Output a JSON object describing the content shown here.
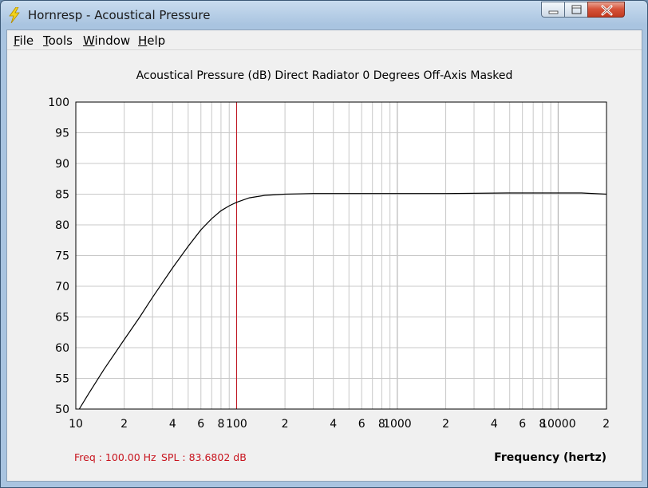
{
  "window": {
    "title": "Hornresp - Acoustical Pressure",
    "controls": [
      "minimize",
      "maximize",
      "close"
    ]
  },
  "menu": {
    "items": [
      {
        "label": "File",
        "mnemonic": "F"
      },
      {
        "label": "Tools",
        "mnemonic": "T"
      },
      {
        "label": "Window",
        "mnemonic": "W"
      },
      {
        "label": "Help",
        "mnemonic": "H"
      }
    ]
  },
  "readout": {
    "freq": "Freq : 100.00 Hz",
    "spl": "SPL : 83.6802 dB"
  },
  "colors": {
    "curve": "#000000",
    "cursor": "#c0101c",
    "grid": "#c8c8c8",
    "grid_decade": "#a8a8a8",
    "readout": "#c8141e"
  },
  "icons": [
    "lightning-bolt-icon",
    "minimize-icon",
    "maximize-icon",
    "close-icon"
  ],
  "chart_data": {
    "type": "line",
    "title": "Acoustical Pressure (dB)   Direct Radiator   0 Degrees Off-Axis   Masked",
    "xlabel": "Frequency (hertz)",
    "ylabel": "",
    "x_scale": "log",
    "xlim": [
      10,
      20000
    ],
    "ylim": [
      50,
      100
    ],
    "grid": true,
    "yticks": [
      100,
      95,
      90,
      85,
      80,
      75,
      70,
      65,
      60,
      55,
      50
    ],
    "xtick_labels": [
      {
        "x": 10,
        "label": "10"
      },
      {
        "x": 20,
        "label": "2"
      },
      {
        "x": 40,
        "label": "4"
      },
      {
        "x": 60,
        "label": "6"
      },
      {
        "x": 80,
        "label": "8"
      },
      {
        "x": 100,
        "label": "100"
      },
      {
        "x": 200,
        "label": "2"
      },
      {
        "x": 400,
        "label": "4"
      },
      {
        "x": 600,
        "label": "6"
      },
      {
        "x": 800,
        "label": "8"
      },
      {
        "x": 1000,
        "label": "1000"
      },
      {
        "x": 2000,
        "label": "2"
      },
      {
        "x": 4000,
        "label": "4"
      },
      {
        "x": 6000,
        "label": "6"
      },
      {
        "x": 8000,
        "label": "8"
      },
      {
        "x": 10000,
        "label": "10000"
      },
      {
        "x": 20000,
        "label": "2"
      }
    ],
    "cursor_x": 100,
    "series": [
      {
        "x": [
          10.5,
          12,
          15,
          20,
          25,
          30,
          40,
          50,
          60,
          70,
          80,
          90,
          100,
          120,
          150,
          200,
          300,
          500,
          1000,
          2000,
          5000,
          10000,
          14000,
          20000
        ],
        "y": [
          50,
          52.5,
          56.5,
          61.3,
          65,
          68.2,
          73.0,
          76.5,
          79.2,
          81.0,
          82.3,
          83.1,
          83.68,
          84.4,
          84.8,
          85.0,
          85.1,
          85.1,
          85.1,
          85.1,
          85.2,
          85.2,
          85.2,
          85.0
        ]
      }
    ]
  }
}
